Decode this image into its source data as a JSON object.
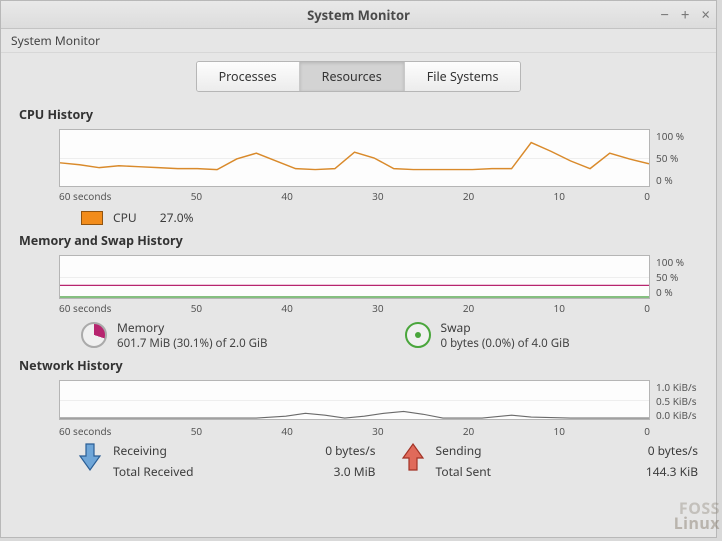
{
  "window": {
    "title": "System Monitor",
    "menu_item": "System Monitor",
    "controls": {
      "min": "−",
      "max": "+",
      "close": "×"
    }
  },
  "tabs": {
    "processes": "Processes",
    "resources": "Resources",
    "filesystems": "File Systems"
  },
  "cpu": {
    "title": "CPU History",
    "y": {
      "top": "100 %",
      "mid": "50 %",
      "bot": "0 %"
    },
    "legend_label": "CPU",
    "legend_value": "27.0%"
  },
  "mem": {
    "title": "Memory and Swap History",
    "y": {
      "top": "100 %",
      "mid": "50 %",
      "bot": "0 %"
    },
    "memory_label": "Memory",
    "memory_value": "601.7 MiB (30.1%) of 2.0 GiB",
    "swap_label": "Swap",
    "swap_value": "0 bytes (0.0%) of 4.0 GiB"
  },
  "net": {
    "title": "Network History",
    "y": {
      "top": "1.0 KiB/s",
      "mid": "0.5 KiB/s",
      "bot": "0.0 KiB/s"
    },
    "recv_label": "Receiving",
    "recv_rate": "0 bytes/s",
    "recv_total_label": "Total Received",
    "recv_total": "3.0 MiB",
    "send_label": "Sending",
    "send_rate": "0 bytes/s",
    "send_total_label": "Total Sent",
    "send_total": "144.3 KiB"
  },
  "xaxis": {
    "t60": "60 seconds",
    "t50": "50",
    "t40": "40",
    "t30": "30",
    "t20": "20",
    "t10": "10",
    "t0": "0"
  },
  "colors": {
    "cpu": "#d98a2b",
    "memory": "#b7256f",
    "swap": "#3e9a37",
    "net_recv": "#4a77b3",
    "net_send": "#c6453a"
  },
  "watermark": {
    "l1": "FOSS",
    "l2": "Linux"
  },
  "chart_data": [
    {
      "type": "line",
      "title": "CPU History",
      "xlabel": "seconds",
      "ylabel": "%",
      "ylim": [
        0,
        100
      ],
      "x": [
        60,
        58,
        56,
        54,
        52,
        50,
        48,
        46,
        44,
        42,
        40,
        38,
        36,
        34,
        32,
        30,
        28,
        26,
        24,
        22,
        20,
        18,
        16,
        14,
        12,
        10,
        8,
        6,
        4,
        2,
        0
      ],
      "series": [
        {
          "name": "CPU",
          "color": "#d98a2b",
          "values": [
            42,
            38,
            32,
            36,
            34,
            32,
            30,
            30,
            28,
            48,
            58,
            44,
            30,
            28,
            30,
            60,
            50,
            30,
            28,
            28,
            28,
            28,
            30,
            30,
            78,
            62,
            44,
            30,
            58,
            48,
            40
          ]
        }
      ]
    },
    {
      "type": "line",
      "title": "Memory and Swap History",
      "xlabel": "seconds",
      "ylabel": "%",
      "ylim": [
        0,
        100
      ],
      "x": [
        60,
        0
      ],
      "series": [
        {
          "name": "Memory",
          "color": "#b7256f",
          "values": [
            30,
            30
          ]
        },
        {
          "name": "Swap",
          "color": "#3e9a37",
          "values": [
            0,
            0
          ]
        }
      ]
    },
    {
      "type": "line",
      "title": "Network History",
      "xlabel": "seconds",
      "ylabel": "KiB/s",
      "ylim": [
        0,
        1.0
      ],
      "x": [
        60,
        50,
        40,
        35,
        32,
        30,
        28,
        25,
        22,
        20,
        18,
        15,
        12,
        10,
        5,
        0
      ],
      "series": [
        {
          "name": "Receiving",
          "color": "#4a77b3",
          "values": [
            0,
            0,
            0,
            0.05,
            0.15,
            0.1,
            0,
            0.05,
            0.12,
            0.2,
            0.08,
            0,
            0,
            0.1,
            0.05,
            0
          ]
        },
        {
          "name": "Sending",
          "color": "#c6453a",
          "values": [
            0,
            0,
            0,
            0,
            0.05,
            0,
            0,
            0,
            0.05,
            0.08,
            0,
            0,
            0,
            0,
            0,
            0
          ]
        }
      ]
    }
  ]
}
